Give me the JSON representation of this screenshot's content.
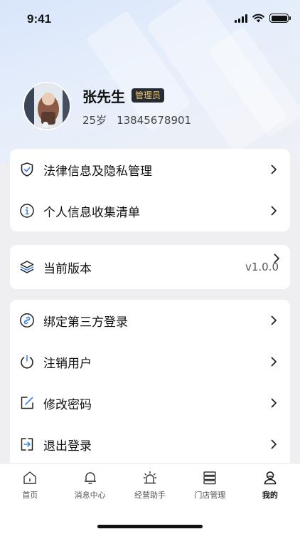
{
  "status_bar": {
    "time": "9:41"
  },
  "profile": {
    "name": "张先生",
    "role": "管理员",
    "age": "25岁",
    "phone": "13845678901"
  },
  "menu_groups": [
    [
      {
        "label": "法律信息及隐私管理",
        "icon": "shield-check-icon"
      },
      {
        "label": "个人信息收集清单",
        "icon": "info-circle-icon"
      }
    ],
    [
      {
        "label": "当前版本",
        "icon": "layers-icon",
        "value": "v1.0.0"
      }
    ],
    [
      {
        "label": "绑定第三方登录",
        "icon": "link-icon"
      },
      {
        "label": "注销用户",
        "icon": "power-icon"
      },
      {
        "label": "修改密码",
        "icon": "edit-icon"
      },
      {
        "label": "退出登录",
        "icon": "logout-icon"
      }
    ]
  ],
  "tabbar": [
    {
      "label": "首页",
      "icon": "home-icon"
    },
    {
      "label": "消息中心",
      "icon": "bell-icon"
    },
    {
      "label": "经营助手",
      "icon": "alarm-light-icon"
    },
    {
      "label": "门店管理",
      "icon": "server-stack-icon"
    },
    {
      "label": "我的",
      "icon": "user-icon",
      "active": true
    }
  ],
  "colors": {
    "badge_bg": "#262a33",
    "badge_text": "#f0c96d",
    "hero_gradient_start": "#d8e6fb",
    "page_bg": "#efeff1"
  }
}
